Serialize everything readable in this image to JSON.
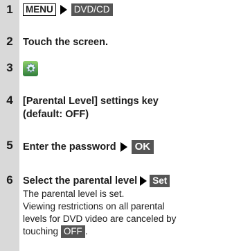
{
  "steps": [
    {
      "number": "1",
      "menu_key": "MENU",
      "dvd_key": "DVD/CD"
    },
    {
      "number": "2",
      "text": "Touch the screen."
    },
    {
      "number": "3",
      "icon": "gear-icon"
    },
    {
      "number": "4",
      "line1": "[Parental Level] settings key",
      "line2": "(default: OFF)"
    },
    {
      "number": "5",
      "text": "Enter the password",
      "key": "OK"
    },
    {
      "number": "6",
      "text": "Select the parental level",
      "key": "Set",
      "desc1": "The parental level is set.",
      "desc2": "Viewing restrictions on all parental",
      "desc3": "levels for DVD video are canceled by",
      "desc4_pre": "touching",
      "desc4_key": "OFF",
      "desc4_post": "."
    }
  ]
}
